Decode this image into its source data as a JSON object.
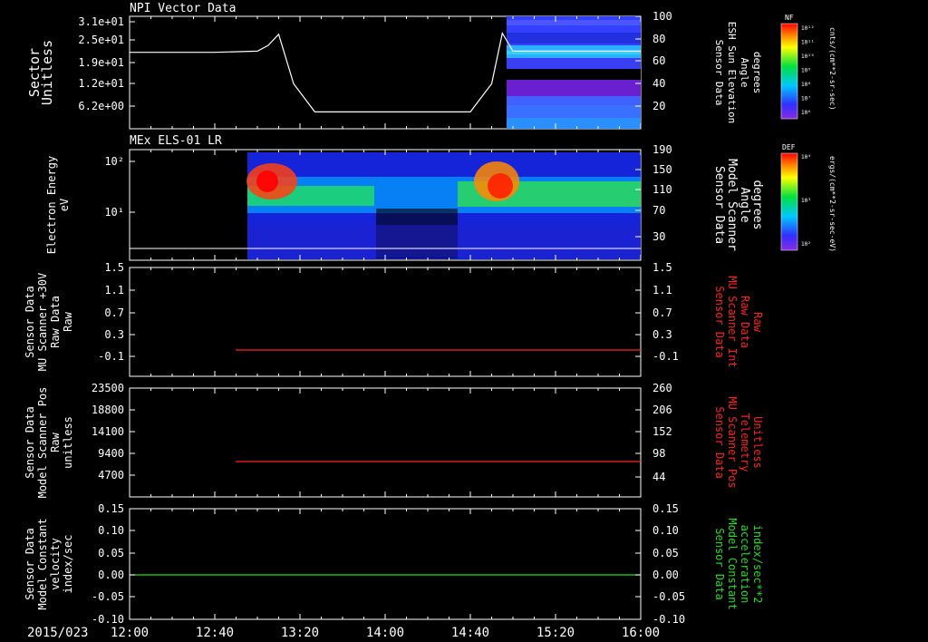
{
  "date_label": "2015/023",
  "time_ticks": [
    "12:00",
    "12:40",
    "13:20",
    "14:00",
    "14:40",
    "15:20",
    "16:00"
  ],
  "colors": {
    "white": "#ffffff",
    "red": "#ff2020",
    "green": "#22dd22"
  },
  "colorbars": [
    {
      "title": "NF",
      "unit": "cnts/(cm**2-sr-sec)",
      "ticks": [
        "10¹²",
        "10¹¹",
        "10¹⁰",
        "10⁹",
        "10⁸",
        "10⁷",
        "10⁶"
      ]
    },
    {
      "title": "DEF",
      "unit": "ergs/(cm**2-sr-sec-eV)",
      "ticks": [
        "10⁴",
        "10³",
        "10²"
      ]
    }
  ],
  "chart_data": [
    {
      "type": "line",
      "title": "NPI Vector Data",
      "ylabel": [
        "Sector",
        "Unitless"
      ],
      "left_ticks": [
        "3.1e+01",
        "2.5e+01",
        "1.9e+01",
        "1.2e+01",
        "6.2e+00"
      ],
      "right_ticks": [
        "100",
        "80",
        "60",
        "40",
        "20"
      ],
      "right_ylabel": [
        "Sensor Data",
        "ESH Sun Elevation",
        "Angle",
        "degrees"
      ],
      "right_ylim": [
        0,
        100
      ],
      "series": [
        {
          "name": "ESH Sun Elevation Angle",
          "color": "white",
          "x": [
            "12:00",
            "12:40",
            "13:00",
            "13:05",
            "13:10",
            "13:17",
            "13:27",
            "14:40",
            "14:50",
            "14:55",
            "15:00",
            "16:00"
          ],
          "y": [
            68,
            68,
            69,
            74,
            84,
            40,
            15,
            15,
            40,
            85,
            69,
            69
          ]
        }
      ]
    },
    {
      "type": "heatmap",
      "title": "MEx ELS-01 LR",
      "ylabel": [
        "Electron Energy",
        "eV"
      ],
      "left_ticks": [
        "10²",
        "10¹"
      ],
      "right_ticks": [
        "190",
        "150",
        "110",
        "70",
        "30"
      ],
      "right_ylabel": [
        "Sensor Data",
        "Model Scanner",
        "Angle",
        "degrees"
      ],
      "series": [
        {
          "name": "Model Scanner Angle",
          "color": "white",
          "x": [
            "12:00",
            "16:00"
          ],
          "y": [
            18,
            18
          ]
        }
      ]
    },
    {
      "type": "line",
      "left_ticks": [
        "1.5",
        "1.1",
        "0.7",
        "0.3",
        "-0.1"
      ],
      "right_ticks": [
        "1.5",
        "1.1",
        "0.7",
        "0.3",
        "-0.1"
      ],
      "ylabel": [
        "Sensor Data",
        "MU Scanner +30V",
        "Raw Data",
        "Raw"
      ],
      "right_ylabel": [
        "Sensor Data",
        "MU Scanner Int",
        "Raw Data",
        "Raw"
      ],
      "ylim": [
        -0.3,
        1.5
      ],
      "series": [
        {
          "name": "MU Scanner Int Raw Data",
          "color": "red",
          "x": [
            "12:50",
            "16:00"
          ],
          "y": [
            0,
            0
          ]
        }
      ]
    },
    {
      "type": "line",
      "left_ticks": [
        "23500",
        "18800",
        "14100",
        "9400",
        "4700"
      ],
      "right_ticks": [
        "260",
        "206",
        "152",
        "98",
        "44"
      ],
      "ylabel": [
        "Sensor Data",
        "Model Scanner Pos",
        "Raw",
        "unitless"
      ],
      "right_ylabel": [
        "Sensor Data",
        "MU Scanner Pos",
        "Telemetry",
        "Unitless"
      ],
      "ylim": [
        0,
        23500
      ],
      "series": [
        {
          "name": "MU Scanner Pos Telemetry",
          "color": "red",
          "x": [
            "12:50",
            "16:00"
          ],
          "y": [
            8000,
            8000
          ]
        }
      ]
    },
    {
      "type": "line",
      "left_ticks": [
        "0.15",
        "0.10",
        "0.05",
        "0.00",
        "-0.05",
        "-0.10"
      ],
      "right_ticks": [
        "0.15",
        "0.10",
        "0.05",
        "0.00",
        "-0.05",
        "-0.10"
      ],
      "ylabel": [
        "Sensor Data",
        "Model Constant",
        "velocity",
        "index/sec"
      ],
      "right_ylabel": [
        "Sensor Data",
        "Model Constant",
        "acceleration",
        "index/sec**2"
      ],
      "ylim": [
        -0.1,
        0.15
      ],
      "series": [
        {
          "name": "Model Constant acceleration",
          "color": "green",
          "x": [
            "12:00",
            "16:00"
          ],
          "y": [
            0,
            0
          ]
        }
      ]
    }
  ]
}
